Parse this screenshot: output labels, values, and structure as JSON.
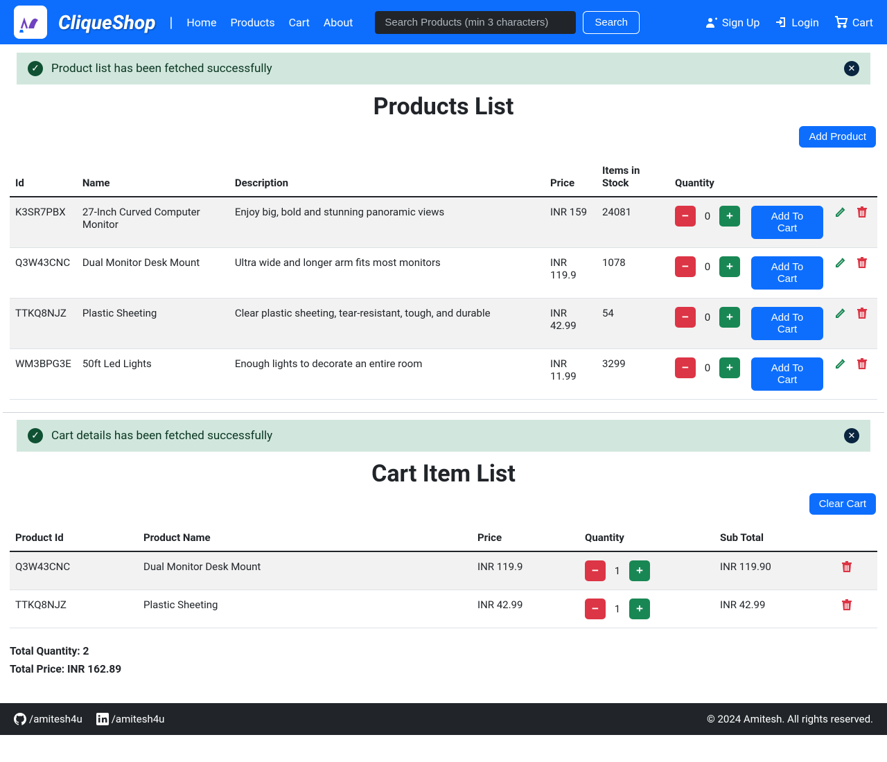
{
  "brand": "CliqueShop",
  "nav": {
    "home": "Home",
    "products": "Products",
    "cart": "Cart",
    "about": "About"
  },
  "search": {
    "placeholder": "Search Products (min 3 characters)",
    "button": "Search"
  },
  "auth": {
    "signup": "Sign Up",
    "login": "Login",
    "cart": "Cart"
  },
  "alerts": {
    "products": "Product list has been fetched successfully",
    "cart": "Cart details has been fetched successfully"
  },
  "products": {
    "title": "Products List",
    "add_button": "Add Product",
    "add_to_cart": "Add To Cart",
    "headers": {
      "id": "Id",
      "name": "Name",
      "desc": "Description",
      "price": "Price",
      "stock": "Items in Stock",
      "qty": "Quantity"
    },
    "rows": [
      {
        "id": "K3SR7PBX",
        "name": "27-Inch Curved Computer Monitor",
        "desc": "Enjoy big, bold and stunning panoramic views",
        "price": "INR 159",
        "stock": "24081",
        "qty": "0"
      },
      {
        "id": "Q3W43CNC",
        "name": "Dual Monitor Desk Mount",
        "desc": "Ultra wide and longer arm fits most monitors",
        "price": "INR 119.9",
        "stock": "1078",
        "qty": "0"
      },
      {
        "id": "TTKQ8NJZ",
        "name": "Plastic Sheeting",
        "desc": "Clear plastic sheeting, tear-resistant, tough, and durable",
        "price": "INR 42.99",
        "stock": "54",
        "qty": "0"
      },
      {
        "id": "WM3BPG3E",
        "name": "50ft Led Lights",
        "desc": "Enough lights to decorate an entire room",
        "price": "INR 11.99",
        "stock": "3299",
        "qty": "0"
      }
    ]
  },
  "cart": {
    "title": "Cart Item List",
    "clear_button": "Clear Cart",
    "headers": {
      "pid": "Product Id",
      "pname": "Product Name",
      "price": "Price",
      "qty": "Quantity",
      "sub": "Sub Total"
    },
    "rows": [
      {
        "pid": "Q3W43CNC",
        "pname": "Dual Monitor Desk Mount",
        "price": "INR 119.9",
        "qty": "1",
        "sub": "INR 119.90"
      },
      {
        "pid": "TTKQ8NJZ",
        "pname": "Plastic Sheeting",
        "price": "INR 42.99",
        "qty": "1",
        "sub": "INR 42.99"
      }
    ],
    "total_qty_label": "Total Quantity: ",
    "total_qty": "2",
    "total_price_label": "Total Price: ",
    "total_price": "INR 162.89"
  },
  "footer": {
    "github": "/amitesh4u",
    "linkedin": "/amitesh4u",
    "copy": "© 2024 Amitesh. All rights reserved."
  }
}
